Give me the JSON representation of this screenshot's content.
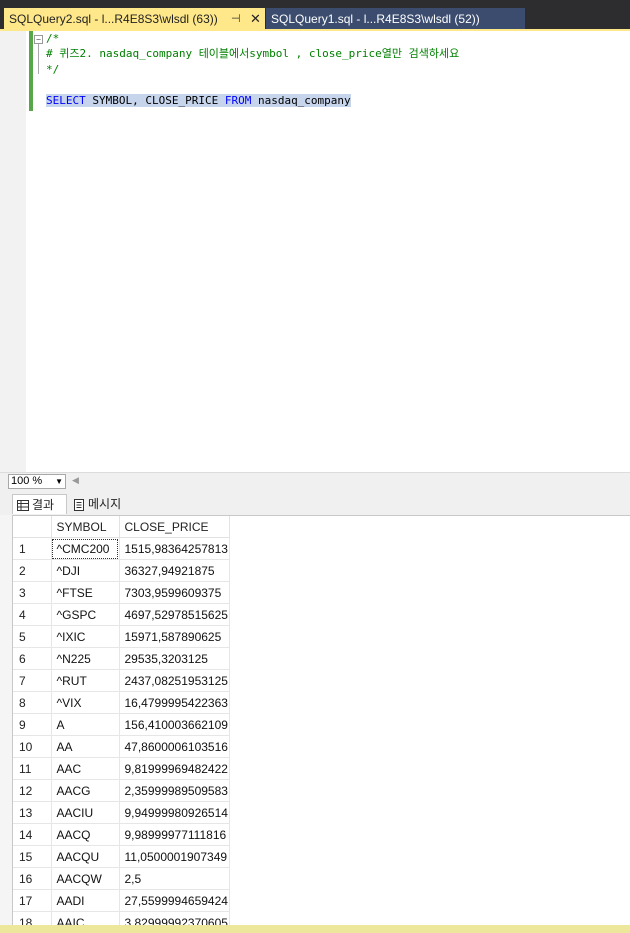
{
  "tabs": [
    {
      "title": "SQLQuery2.sql - l...R4E8S3\\wlsdl (63))",
      "pin": "⊣",
      "close": "✕"
    },
    {
      "title": "SQLQuery1.sql - l...R4E8S3\\wlsdl (52))"
    }
  ],
  "editor": {
    "fold_marker": "−",
    "lines": [
      "/*",
      "# 퀴즈2. nasdaq_company 테이블에서symbol , close_price열만 검색하세요",
      "*/"
    ],
    "query": {
      "kw1": "SELECT",
      "cols": " SYMBOL, CLOSE_PRICE ",
      "kw2": "FROM",
      "table": " nasdaq_company"
    }
  },
  "zoom": {
    "value": "100 %"
  },
  "results_tabs": {
    "results": "결과",
    "messages": "메시지"
  },
  "grid": {
    "columns": [
      "SYMBOL",
      "CLOSE_PRICE"
    ],
    "rows": [
      [
        "1",
        "^CMC200",
        "1515,98364257813"
      ],
      [
        "2",
        "^DJI",
        "36327,94921875"
      ],
      [
        "3",
        "^FTSE",
        "7303,9599609375"
      ],
      [
        "4",
        "^GSPC",
        "4697,52978515625"
      ],
      [
        "5",
        "^IXIC",
        "15971,587890625"
      ],
      [
        "6",
        "^N225",
        "29535,3203125"
      ],
      [
        "7",
        "^RUT",
        "2437,08251953125"
      ],
      [
        "8",
        "^VIX",
        "16,4799995422363"
      ],
      [
        "9",
        "A",
        "156,410003662109"
      ],
      [
        "10",
        "AA",
        "47,8600006103516"
      ],
      [
        "11",
        "AAC",
        "9,81999969482422"
      ],
      [
        "12",
        "AACG",
        "2,35999989509583"
      ],
      [
        "13",
        "AACIU",
        "9,94999980926514"
      ],
      [
        "14",
        "AACQ",
        "9,98999977111816"
      ],
      [
        "15",
        "AACQU",
        "11,0500001907349"
      ],
      [
        "16",
        "AACQW",
        "2,5"
      ],
      [
        "17",
        "AADI",
        "27,5599994659424"
      ],
      [
        "18",
        "AAIC",
        "3,82999992370605"
      ]
    ]
  }
}
